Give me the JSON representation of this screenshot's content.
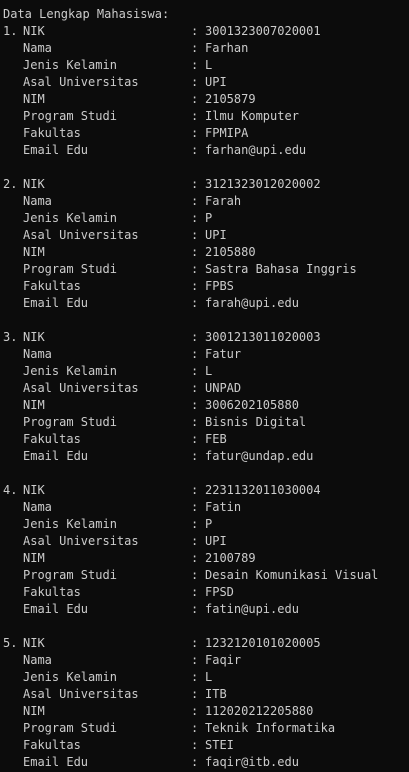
{
  "header": "Data Lengkap Mahasiswa:",
  "labels": {
    "nik": "NIK",
    "nama": "Nama",
    "jk": "Jenis Kelamin",
    "univ": "Asal Universitas",
    "nim": "NIM",
    "prodi": "Program Studi",
    "fakultas": "Fakultas",
    "email": "Email Edu",
    "separator": ":"
  },
  "records": [
    {
      "no": "1.",
      "nik": "3001323007020001",
      "nama": "Farhan",
      "jk": "L",
      "univ": "UPI",
      "nim": "2105879",
      "prodi": "Ilmu Komputer",
      "fakultas": "FPMIPA",
      "email": "farhan@upi.edu"
    },
    {
      "no": "2.",
      "nik": "3121323012020002",
      "nama": "Farah",
      "jk": "P",
      "univ": "UPI",
      "nim": "2105880",
      "prodi": "Sastra Bahasa Inggris",
      "fakultas": "FPBS",
      "email": "farah@upi.edu"
    },
    {
      "no": "3.",
      "nik": "3001213011020003",
      "nama": "Fatur",
      "jk": "L",
      "univ": "UNPAD",
      "nim": "3006202105880",
      "prodi": "Bisnis Digital",
      "fakultas": "FEB",
      "email": "fatur@undap.edu"
    },
    {
      "no": "4.",
      "nik": "2231132011030004",
      "nama": "Fatin",
      "jk": "P",
      "univ": "UPI",
      "nim": "2100789",
      "prodi": "Desain Komunikasi Visual",
      "fakultas": "FPSD",
      "email": "fatin@upi.edu"
    },
    {
      "no": "5.",
      "nik": "1232120101020005",
      "nama": "Faqir",
      "jk": "L",
      "univ": "ITB",
      "nim": "112020212205880",
      "prodi": "Teknik Informatika",
      "fakultas": "STEI",
      "email": "faqir@itb.edu"
    }
  ]
}
